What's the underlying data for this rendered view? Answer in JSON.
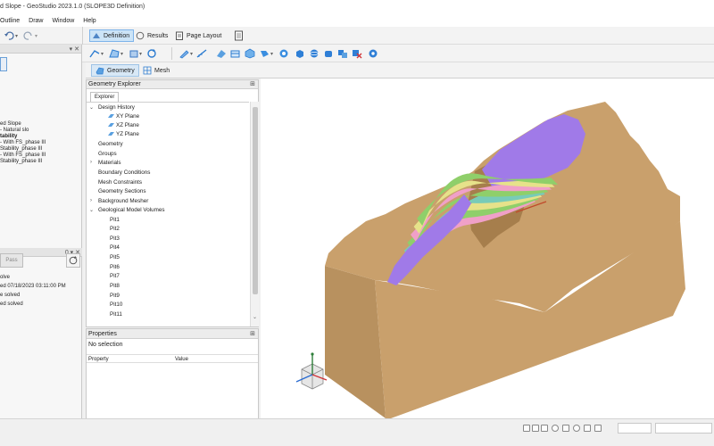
{
  "window": {
    "title": "d Slope - GeoStudio 2023.1.0 (SLOPE3D Definition)"
  },
  "menu": [
    "Outline",
    "Draw",
    "Window",
    "Help"
  ],
  "modes": {
    "definition": "Definition",
    "results": "Results",
    "page_layout": "Page Layout"
  },
  "view_tabs": {
    "geometry": "Geometry",
    "mesh": "Mesh"
  },
  "left_panel": {
    "analyses": [
      "ed Slope",
      "- Natural slo",
      "tability",
      "- With FS_phase III",
      "Stability_phase III",
      "- With FS_phase III",
      "Stability_phase III"
    ],
    "solver": {
      "button": "Pass",
      "lines": [
        "olve",
        "ed 07/18/2023 03:11:00 PM",
        "e solved",
        "ed solved"
      ]
    }
  },
  "geometry_explorer": {
    "title": "Geometry Explorer",
    "tab": "Explorer",
    "tree": {
      "design_history": "Design History",
      "planes": [
        "XY Plane",
        "XZ Plane",
        "YZ Plane"
      ],
      "items": [
        "Geometry",
        "Groups",
        "Materials",
        "Boundary Conditions",
        "Mesh Constraints",
        "Geometry Sections",
        "Background Mesher"
      ],
      "geological": "Geological Model Volumes",
      "volumes": [
        "Pit1",
        "Pit2",
        "Pit3",
        "Pit4",
        "Pit5",
        "Pit6",
        "Pit7",
        "Pit8",
        "Pit9",
        "Pit10",
        "Pit11"
      ]
    }
  },
  "properties": {
    "title": "Properties",
    "no_selection": "No selection",
    "col_property": "Property",
    "col_value": "Value"
  },
  "colors": {
    "terrain": "#c9a06c",
    "terrain_dark": "#a67e4c",
    "terrain_side": "#b8915f",
    "layer_purple": "#a07ae8",
    "layer_green": "#8fcf6a",
    "layer_pink": "#f0a0c8",
    "layer_yellow": "#e6e28a",
    "layer_teal": "#78cbb8",
    "accent": "#0078d4"
  }
}
